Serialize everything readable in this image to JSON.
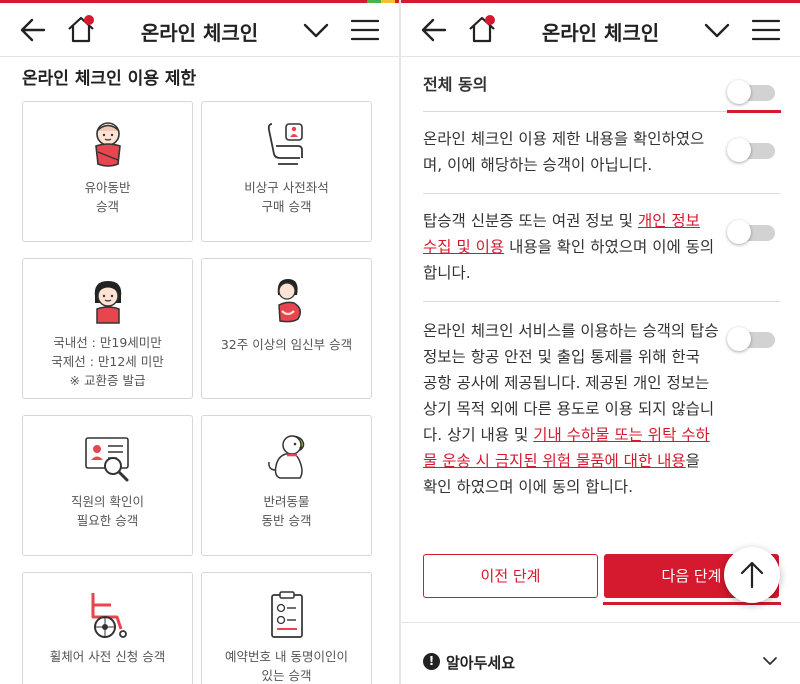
{
  "header": {
    "title": "온라인 체크인"
  },
  "left": {
    "section_title": "온라인 체크인 이용 제한",
    "cards": [
      {
        "line1": "유아동반",
        "line2": "승객",
        "line3": ""
      },
      {
        "line1": "비상구 사전좌석",
        "line2": "구매 승객",
        "line3": ""
      },
      {
        "line1": "국내선 : 만19세미만",
        "line2": "국제선 : 만12세 미만",
        "line3": "※ 교환증 발급"
      },
      {
        "line1": "32주 이상의 임신부 승객",
        "line2": "",
        "line3": ""
      },
      {
        "line1": "직원의 확인이",
        "line2": "필요한 승객",
        "line3": ""
      },
      {
        "line1": "반려동물",
        "line2": "동반 승객",
        "line3": ""
      },
      {
        "line1": "휠체어 사전 신청 승객",
        "line2": "",
        "line3": ""
      },
      {
        "line1": "예약번호 내 동명이인이",
        "line2": "있는 승객",
        "line3": ""
      }
    ]
  },
  "right": {
    "agree_all": "전체 동의",
    "item1": "온라인 체크인 이용 제한 내용을 확인하였으며, 이에 해당하는 승객이 아닙니다.",
    "item2_pre": "탑승객 신분증 또는 여권 정보 및 ",
    "item2_link": "개인 정보 수집 및 이용",
    "item2_post": " 내용을 확인 하였으며 이에 동의 합니다.",
    "item3_pre": "온라인 체크인 서비스를 이용하는 승객의 탑승 정보는 항공 안전 및 출입 통제를 위해 한국 공항 공사에 제공됩니다. 제공된 개인 정보는 상기 목적 외에 다른 용도로 이용 되지 않습니다. 상기 내용 및 ",
    "item3_link": "기내 수하물 또는 위탁 수하물 운송 시 금지된 위험 물품에 대한 내용",
    "item3_post": "을 확인 하였으며 이에 동의 합니다.",
    "prev_button": "이전 단계",
    "next_button": "다음 단계",
    "notice_icon": "!",
    "notice_title": "알아두세요"
  },
  "colors": {
    "accent": "#d5192e",
    "toggle_off": "#d2d2d2"
  }
}
